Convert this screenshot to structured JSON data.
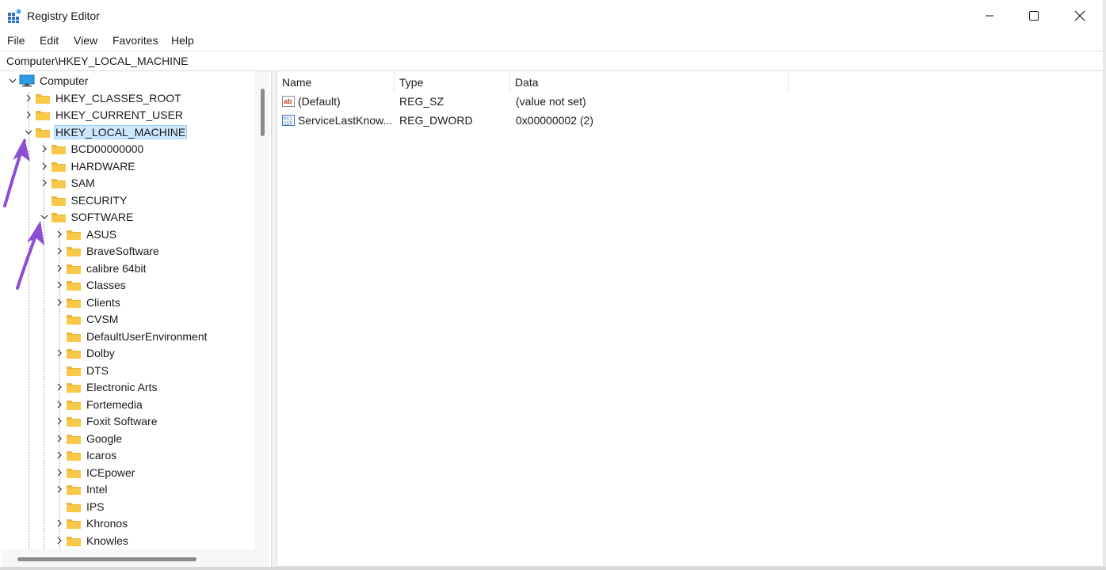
{
  "window": {
    "title": "Registry Editor"
  },
  "menu": [
    "File",
    "Edit",
    "View",
    "Favorites",
    "Help"
  ],
  "address": "Computer\\HKEY_LOCAL_MACHINE",
  "tree": {
    "root": "Computer",
    "hives": [
      "HKEY_CLASSES_ROOT",
      "HKEY_CURRENT_USER",
      "HKEY_LOCAL_MACHINE"
    ],
    "hklm_children": [
      "BCD00000000",
      "HARDWARE",
      "SAM",
      "SECURITY",
      "SOFTWARE"
    ],
    "software_children": [
      "ASUS",
      "BraveSoftware",
      "calibre 64bit",
      "Classes",
      "Clients",
      "CVSM",
      "DefaultUserEnvironment",
      "Dolby",
      "DTS",
      "Electronic Arts",
      "Fortemedia",
      "Foxit Software",
      "Google",
      "Icaros",
      "ICEpower",
      "Intel",
      "IPS",
      "Khronos",
      "Knowles"
    ]
  },
  "columns": [
    "Name",
    "Type",
    "Data"
  ],
  "values": [
    {
      "name": "(Default)",
      "type": "REG_SZ",
      "data": "(value not set)",
      "icon": "string-value-icon"
    },
    {
      "name": "ServiceLastKnow...",
      "type": "REG_DWORD",
      "data": "0x00000002 (2)",
      "icon": "binary-value-icon"
    }
  ],
  "colors": {
    "selection": "#cce8ff",
    "selection_border": "#99d1ff",
    "folder": "#f8c948",
    "arrow": "#8b4fd6"
  }
}
